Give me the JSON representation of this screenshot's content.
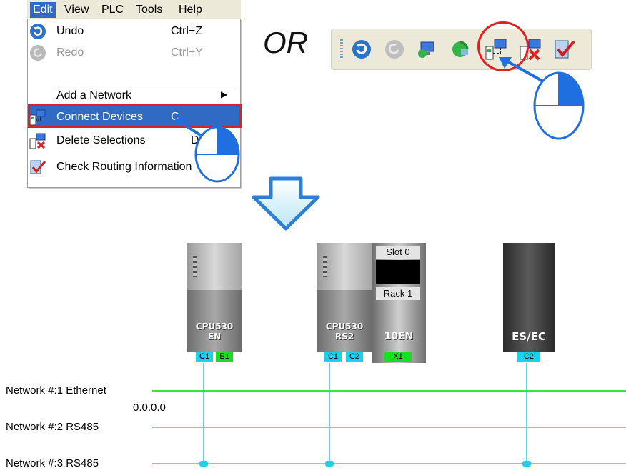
{
  "menubar": {
    "items": [
      "Edit",
      "View",
      "PLC",
      "Tools",
      "Help"
    ]
  },
  "edit_menu": {
    "items": [
      {
        "label": "Undo",
        "shortcut": "Ctrl+Z",
        "enabled": true,
        "icon": "undo-icon"
      },
      {
        "label": "Redo",
        "shortcut": "Ctrl+Y",
        "enabled": false,
        "icon": "redo-icon"
      },
      {
        "label": "Add a Network",
        "shortcut": "",
        "enabled": true,
        "submenu": true
      },
      {
        "label": "Connect Devices",
        "shortcut": "C",
        "enabled": true,
        "highlighted": true,
        "icon": "connect-devices-icon"
      },
      {
        "label": "Delete Selections",
        "shortcut": "D",
        "enabled": true,
        "icon": "delete-selections-icon"
      },
      {
        "label": "Check Routing Information",
        "shortcut": "",
        "enabled": true,
        "icon": "check-routing-icon"
      }
    ]
  },
  "or_text": "OR",
  "toolbar": {
    "buttons": [
      "undo-icon",
      "redo-icon",
      "network-icon",
      "network-refresh-icon",
      "connect-devices-icon",
      "delete-selections-icon",
      "check-routing-icon"
    ]
  },
  "devices": [
    {
      "name_line1": "CPU530",
      "name_line2": "EN",
      "ports": [
        "C1",
        "E1"
      ]
    },
    {
      "name_line1": "CPU530",
      "name_line2": "RS2",
      "ports": [
        "C1",
        "C2"
      ]
    },
    {
      "slot": "Slot 0",
      "rack": "Rack 1",
      "name_line1": "10EN",
      "ports": [
        "X1"
      ]
    },
    {
      "name_line1": "ES/EC",
      "ports": [
        "C2"
      ]
    }
  ],
  "networks": [
    {
      "label": "Network #:1  Ethernet",
      "color": "#3fe03f"
    },
    {
      "label": "Network #:2  RS485",
      "color": "#5ed6e6"
    },
    {
      "label": "Network #:3  RS485",
      "color": "#5ed6e6"
    }
  ],
  "ip_address": "0.0.0.0",
  "colors": {
    "highlight": "#316ac5",
    "callout_red": "#e0201f",
    "pointer_blue": "#1f6fe0"
  }
}
